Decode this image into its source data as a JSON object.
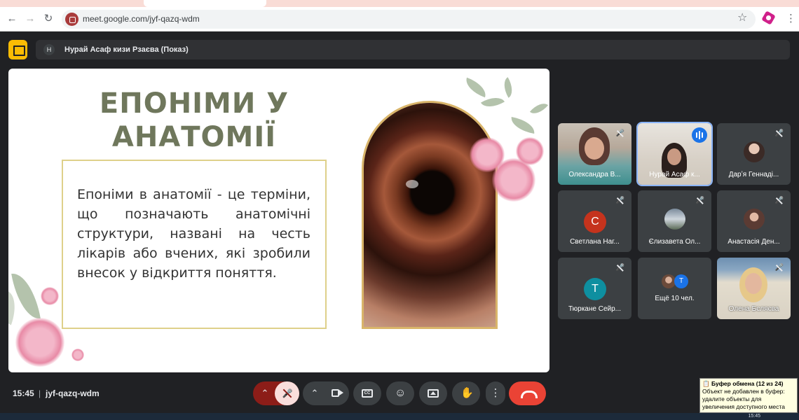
{
  "browser": {
    "url": "meet.google.com/jyf-qazq-wdm"
  },
  "meet": {
    "presenter_avatar": "Н",
    "presenter_label": "Нурай Асаф кизи Рзаєва (Показ)",
    "time": "15:45",
    "separator": "|",
    "meeting_code": "jyf-qazq-wdm"
  },
  "slide": {
    "title_line1": "ЕПОНІМИ У",
    "title_line2": "АНАТОМІЇ",
    "body": "Епоніми в анатомії - це терміни, що позначають анатомічні структури, названі на честь лікарів або вчених, які зробили внесок у відкриття поняття."
  },
  "participants": [
    {
      "name": "Олександра В...",
      "muted": true,
      "kind": "photo"
    },
    {
      "name": "Нурай Асаф к...",
      "muted": false,
      "speaking": true,
      "kind": "photo"
    },
    {
      "name": "Дарʼя Геннаді...",
      "muted": true,
      "kind": "small-photo"
    },
    {
      "name": "Светлана Наг...",
      "muted": true,
      "kind": "letter",
      "letter": "С",
      "color": "#c5331d"
    },
    {
      "name": "Єлизавета Ол...",
      "muted": true,
      "kind": "small-photo"
    },
    {
      "name": "Анастасія Ден...",
      "muted": true,
      "kind": "small-photo"
    },
    {
      "name": "Тюркане Сейр...",
      "muted": true,
      "kind": "letter",
      "letter": "Т",
      "color": "#0e8fa0"
    },
    {
      "name": "Ещё 10 чел.",
      "kind": "more",
      "letter": "Т"
    },
    {
      "name": "Олена Бєляєва",
      "muted": true,
      "kind": "photo"
    }
  ],
  "tooltip": {
    "title": "Буфер обмена (12 из 24)",
    "text": "Объект не добавлен в буфер: удалите объекты для увеличения доступного места"
  },
  "taskbar": {
    "time": "15:45"
  }
}
